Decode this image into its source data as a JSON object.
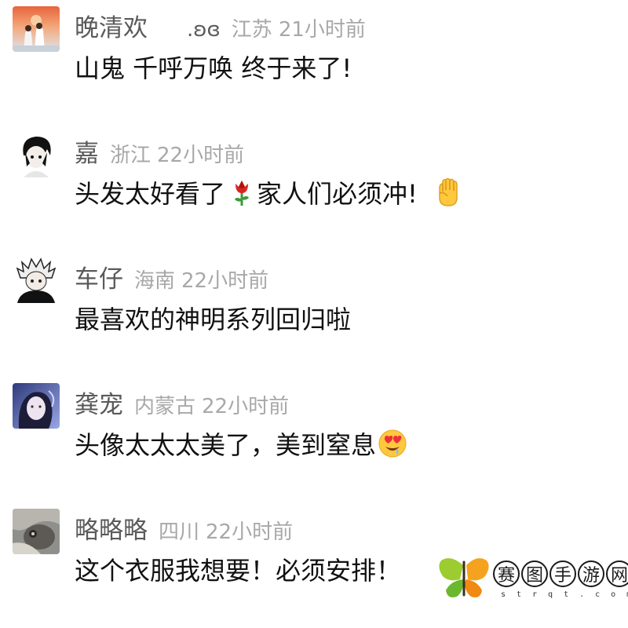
{
  "comments": [
    {
      "username": "晚清欢",
      "username_extra": ".ʚɞ",
      "location": "江苏",
      "time": "21小时前",
      "text": "山鬼 千呼万唤 终于来了!",
      "emoji": ""
    },
    {
      "username": "嘉",
      "username_extra": "",
      "location": "浙江",
      "time": "22小时前",
      "text": "头发太好看了",
      "text_after": "家人们必须冲!",
      "emoji_mid": "rose-icon",
      "emoji": "raised-fist-icon"
    },
    {
      "username": "车仔",
      "username_extra": "",
      "location": "海南",
      "time": "22小时前",
      "text": "最喜欢的神明系列回归啦",
      "emoji": ""
    },
    {
      "username": "龚宠",
      "username_extra": "",
      "location": "内蒙古",
      "time": "22小时前",
      "text": "头像太太太美了，美到窒息",
      "emoji": "heart-eyes-drool-icon"
    },
    {
      "username": "略略略",
      "username_extra": "",
      "location": "四川",
      "time": "22小时前",
      "text": "这个衣服我想要！必须安排！",
      "emoji": ""
    }
  ],
  "watermark": {
    "chars": [
      "赛",
      "图",
      "手",
      "游",
      "网"
    ],
    "url": "strqt.com"
  }
}
